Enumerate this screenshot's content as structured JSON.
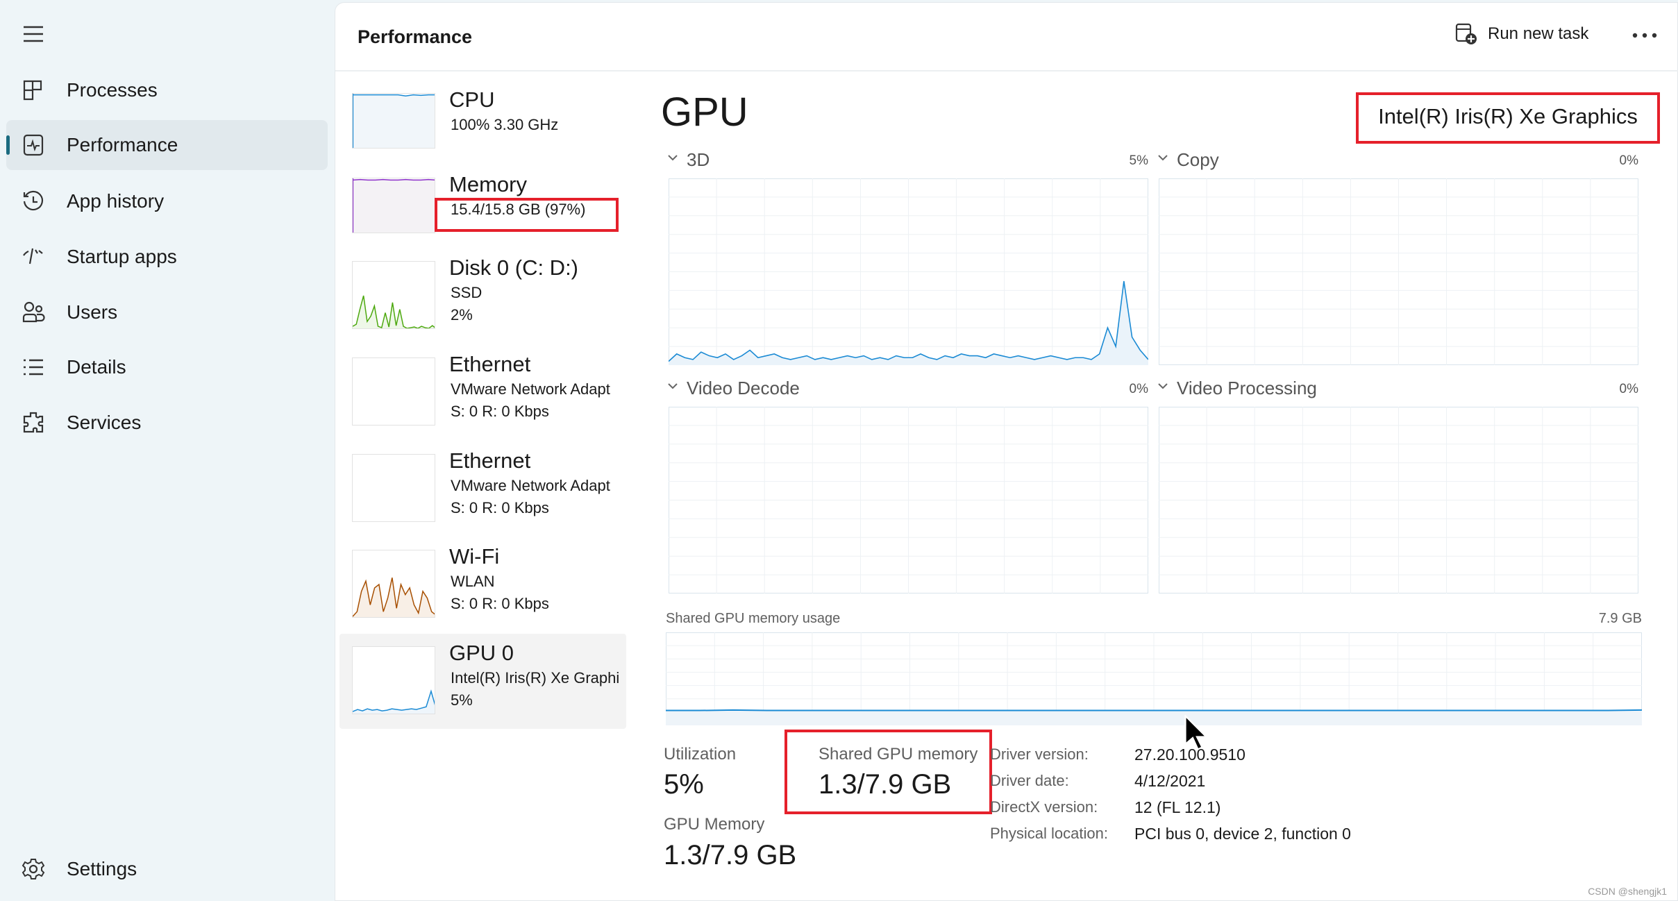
{
  "sidebar": {
    "menu_icon": "hamburger-icon",
    "items": [
      {
        "label": "Processes",
        "icon": "processes-grid-icon"
      },
      {
        "label": "Performance",
        "icon": "performance-pulse-icon",
        "selected": true
      },
      {
        "label": "App history",
        "icon": "history-clock-icon"
      },
      {
        "label": "Startup apps",
        "icon": "startup-gauge-icon"
      },
      {
        "label": "Users",
        "icon": "users-icon"
      },
      {
        "label": "Details",
        "icon": "list-icon"
      },
      {
        "label": "Services",
        "icon": "puzzle-gear-icon"
      }
    ],
    "settings": {
      "label": "Settings",
      "icon": "gear-icon"
    }
  },
  "header": {
    "title": "Performance",
    "run_new_task": "Run new task",
    "more_icon": "more-dots-icon"
  },
  "resources": [
    {
      "title": "CPU",
      "lines": [
        "100%  3.30 GHz"
      ],
      "color": "#1a8ad4"
    },
    {
      "title": "Memory",
      "lines": [
        "15.4/15.8 GB (97%)"
      ],
      "color": "#8b2fc9"
    },
    {
      "title": "Disk 0 (C: D:)",
      "lines": [
        "SSD",
        "2%"
      ],
      "color": "#4ca80e"
    },
    {
      "title": "Ethernet",
      "lines": [
        "VMware Network Adapt",
        "S: 0  R: 0 Kbps"
      ],
      "color": "#a74f01"
    },
    {
      "title": "Ethernet",
      "lines": [
        "VMware Network Adapt",
        "S: 0  R: 0 Kbps"
      ],
      "color": "#a74f01"
    },
    {
      "title": "Wi-Fi",
      "lines": [
        "WLAN",
        "S: 0  R: 0 Kbps"
      ],
      "color": "#a74f01"
    },
    {
      "title": "GPU 0",
      "lines": [
        "Intel(R) Iris(R) Xe Graphi",
        "5%"
      ],
      "color": "#1a8ad4",
      "selected": true
    }
  ],
  "gpu": {
    "title": "GPU",
    "name": "Intel(R) Iris(R) Xe Graphics",
    "engines": [
      {
        "label": "3D",
        "percent": "5%",
        "values": [
          2,
          6,
          4,
          3,
          7,
          5,
          4,
          6,
          3,
          5,
          8,
          4,
          5,
          6,
          4,
          3,
          4,
          5,
          3,
          4,
          3,
          4,
          5,
          4,
          5,
          3,
          4,
          3,
          5,
          4,
          4,
          6,
          4,
          3,
          5,
          4,
          6,
          5,
          5,
          4,
          6,
          5,
          4,
          5,
          4,
          3,
          4,
          5,
          4,
          3,
          4,
          4,
          3,
          6,
          20,
          10,
          45,
          15,
          8,
          3
        ]
      },
      {
        "label": "Copy",
        "percent": "0%",
        "values": []
      },
      {
        "label": "Video Decode",
        "percent": "0%",
        "values": []
      },
      {
        "label": "Video Processing",
        "percent": "0%",
        "values": []
      }
    ],
    "shared_label": "Shared GPU memory usage",
    "shared_max": "7.9 GB",
    "shared_values": [
      16,
      16,
      16.5,
      16,
      16,
      16,
      16,
      16,
      16,
      16,
      16,
      16,
      16,
      16,
      16,
      16,
      16,
      16,
      16,
      16,
      16,
      16,
      16,
      16,
      16,
      16,
      16,
      16,
      16,
      16.5
    ],
    "stats": {
      "utilization_label": "Utilization",
      "utilization": "5%",
      "shared_mem_label": "Shared GPU memory",
      "shared_mem": "1.3/7.9 GB",
      "gpu_mem_label": "GPU Memory",
      "gpu_mem": "1.3/7.9 GB"
    },
    "details": [
      {
        "label": "Driver version:",
        "value": "27.20.100.9510"
      },
      {
        "label": "Driver date:",
        "value": "4/12/2021"
      },
      {
        "label": "DirectX version:",
        "value": "12 (FL 12.1)"
      },
      {
        "label": "Physical location:",
        "value": "PCI bus 0, device 2, function 0"
      }
    ]
  },
  "watermark": "CSDN @shengjk1",
  "colors": {
    "accent": "#1a6b80",
    "gpu_line": "#1a8ad4",
    "highlight": "#e5202b"
  }
}
